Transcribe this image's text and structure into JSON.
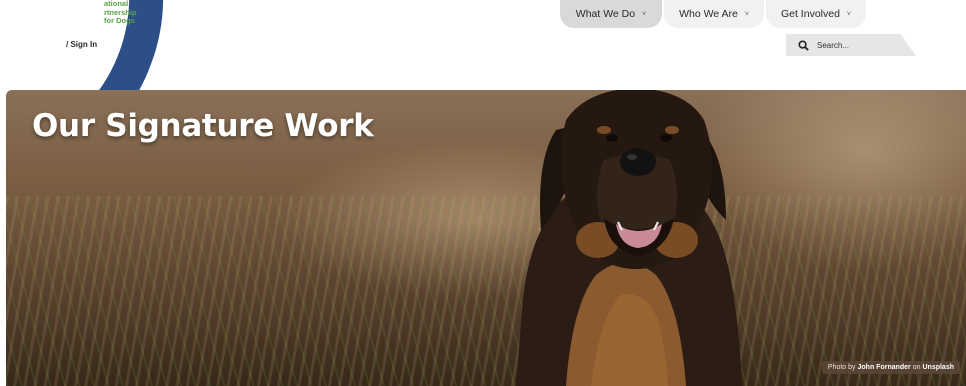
{
  "logo": {
    "text_lines": [
      "ational",
      "rtnership",
      "for Dogs"
    ]
  },
  "header": {
    "signin_label": "/ Sign In"
  },
  "nav": {
    "items": [
      {
        "label": "What We Do",
        "active": true
      },
      {
        "label": "Who We Are",
        "active": false
      },
      {
        "label": "Get Involved",
        "active": false
      }
    ],
    "chevron": "˅"
  },
  "search": {
    "placeholder": "Search..."
  },
  "hero": {
    "title": "Our Signature Work",
    "credit_prefix": "Photo by",
    "credit_author": "John Fornander",
    "credit_middle": "on",
    "credit_site": "Unsplash"
  },
  "colors": {
    "logo_blue": "#2b4f86",
    "logo_green": "#5aa046",
    "nav_active": "#d9d9d9",
    "nav_inactive": "#f1f1f1"
  }
}
